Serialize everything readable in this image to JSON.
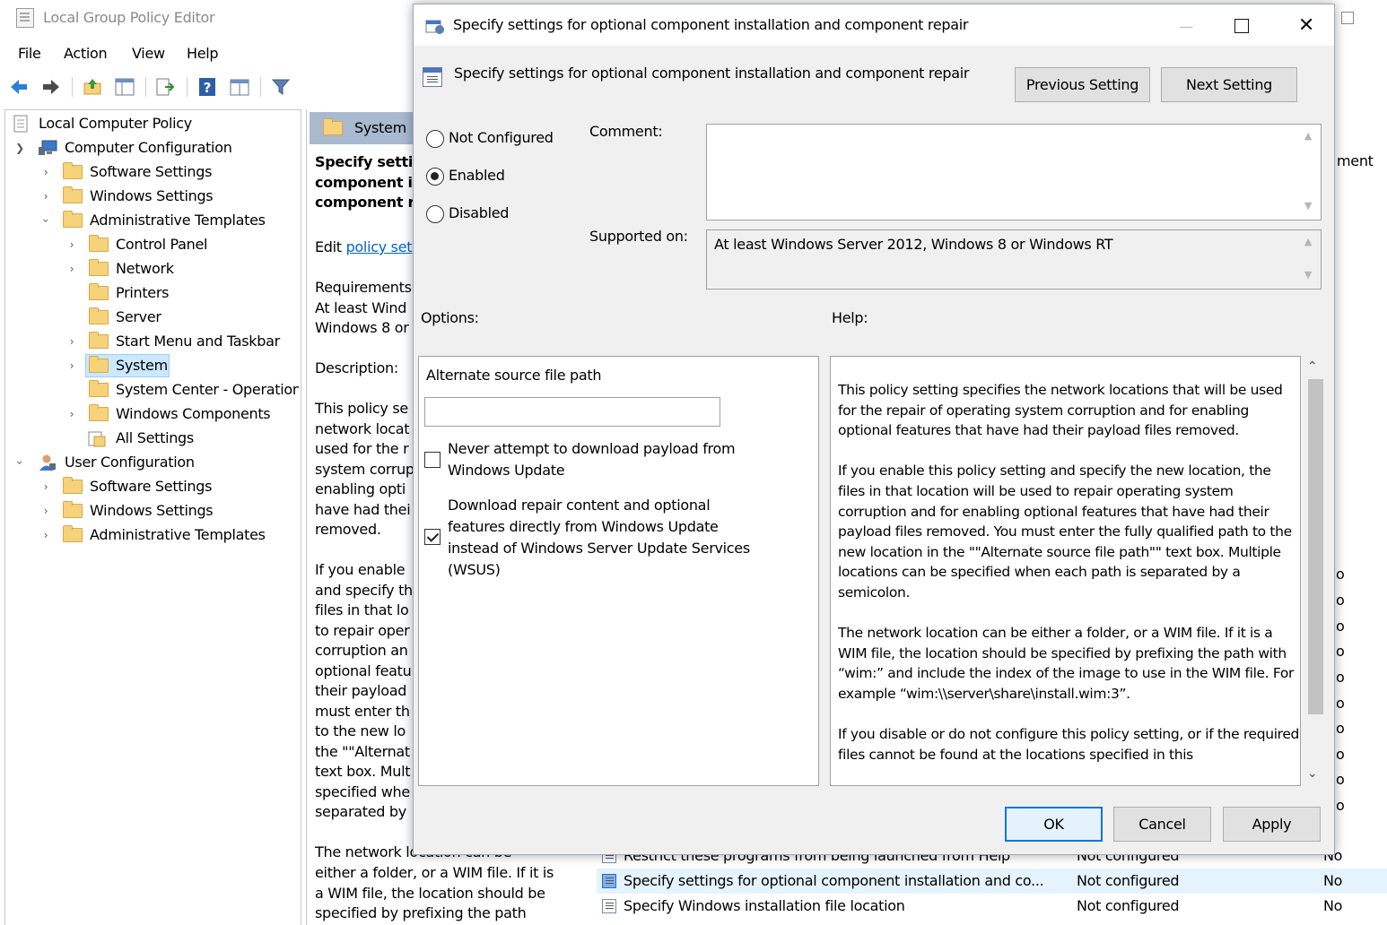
{
  "main_window": {
    "title": "Local Group Policy Editor",
    "menu": [
      "File",
      "Action",
      "View",
      "Help"
    ]
  },
  "tree": {
    "root": "Local Computer Policy",
    "computer_configuration": "Computer Configuration",
    "cc_software_settings": "Software Settings",
    "cc_windows_settings": "Windows Settings",
    "cc_admin_templates": "Administrative Templates",
    "control_panel": "Control Panel",
    "network": "Network",
    "printers": "Printers",
    "server": "Server",
    "start_menu": "Start Menu and Taskbar",
    "system": "System",
    "system_center": "System Center - Operation",
    "windows_components": "Windows Components",
    "all_settings": "All Settings",
    "user_configuration": "User Configuration",
    "uc_software_settings": "Software Settings",
    "uc_windows_settings": "Windows Settings",
    "uc_admin_templates": "Administrative Templates"
  },
  "extended": {
    "header": "System",
    "title_lines": "Specify settin\ncomponent i\ncomponent r",
    "edit_prefix": "Edit ",
    "edit_link": "policy set",
    "requirements": "Requirements\nAt least Wind\nWindows 8 or",
    "description_label": "Description:",
    "description_1": "This policy se\nnetwork locat\nused for the r\nsystem corrup\nenabling opti\nhave had thei\nremoved.",
    "description_2": "If you enable\nand specify th\nfiles in that lo\nto repair oper\ncorruption an\noptional featu\ntheir payload\nmust enter th\nto the new lo\nthe \"\"Alternat\ntext box. Mult\nspecified whe\nseparated by",
    "description_3": "The network location can be\neither a folder, or a WIM file. If it is\na WIM file, the location should be\nspecified by prefixing the path"
  },
  "list": {
    "partial_column_header": "ment",
    "partial_column_marks": [
      "o",
      "o",
      "o",
      "o",
      "o",
      "o",
      "o",
      "o",
      "o",
      "o"
    ],
    "rows": [
      {
        "name": "Restrict these programs from being launched from Help",
        "state": "Not configured",
        "comment": "No"
      },
      {
        "name": "Specify settings for optional component installation and co...",
        "state": "Not configured",
        "comment": "No"
      },
      {
        "name": "Specify Windows installation file location",
        "state": "Not configured",
        "comment": "No"
      }
    ]
  },
  "dialog": {
    "title": "Specify settings for optional component installation and component repair",
    "header_title": "Specify settings for optional component installation and component repair",
    "previous_button": "Previous Setting",
    "next_button": "Next Setting",
    "radio_not_configured": "Not Configured",
    "radio_enabled": "Enabled",
    "radio_disabled": "Disabled",
    "selected_state": "Enabled",
    "comment_label": "Comment:",
    "comment_value": "",
    "supported_on_label": "Supported on:",
    "supported_on_value": "At least Windows Server 2012, Windows 8 or Windows RT",
    "options_label": "Options:",
    "help_label": "Help:",
    "options": {
      "alt_source_label": "Alternate source file path",
      "alt_source_value": "",
      "never_download_label": "Never attempt to download payload from\nWindows Update",
      "never_download_checked": false,
      "download_wu_label": "Download repair content and optional\nfeatures directly from Windows Update\ninstead of Windows Server Update Services\n(WSUS)",
      "download_wu_checked": true
    },
    "help_paragraphs": [
      "This policy setting specifies the network locations that will be used for the repair of operating system corruption and for enabling optional features that have had their payload files removed.",
      "If you enable this policy setting and specify the new location, the files in that location will be used to repair operating system corruption and for enabling optional features that have had their payload files removed. You must enter the fully qualified path to the new location in the \"\"Alternate source file path\"\" text box. Multiple locations can be specified when each path is separated by a semicolon.",
      "The network location can be either a folder, or a WIM file. If it is a WIM file, the location should be specified by prefixing the path with “wim:” and include the index of the image to use in the WIM file. For example “wim:\\\\server\\share\\install.wim:3”.",
      "If you disable or do not configure this policy setting, or if the required files cannot be found at the locations specified in this"
    ],
    "ok_button": "OK",
    "cancel_button": "Cancel",
    "apply_button": "Apply"
  },
  "colors": {
    "selection_bg": "#cce8ff",
    "selection_border": "#99d1ff",
    "header_bar": "#a9b9cf",
    "dialog_bg": "#f0f0f0",
    "accent": "#0078d7",
    "link": "#0066cc"
  }
}
